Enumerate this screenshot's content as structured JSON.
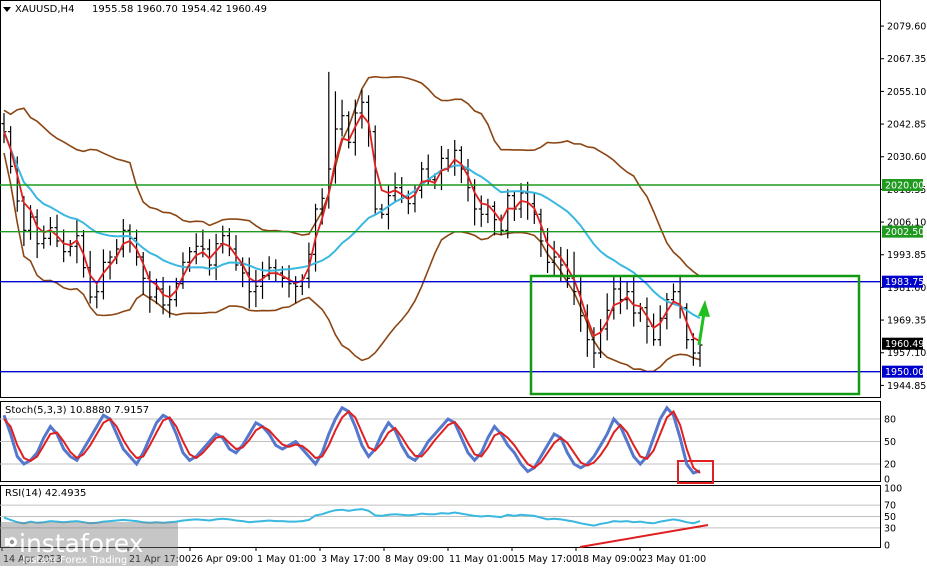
{
  "chart_data": {
    "type": "line",
    "symbol_header": "XAUUSD,H4",
    "ohlc_header": "1955.58 1960.70 1954.42 1960.49",
    "price_axis": {
      "ylim": [
        1940.5,
        2089.0
      ],
      "ticks": [
        "2079.60",
        "2067.35",
        "2055.10",
        "2042.85",
        "2030.60",
        "2018.35",
        "2006.10",
        "1993.85",
        "1981.60",
        "1969.35",
        "1957.10",
        "1944.85"
      ]
    },
    "x_labels": [
      "14 Apr 2023",
      "21 Apr 17:00",
      "26 Apr 09:00",
      "1 May 01:00",
      "3 May 17:00",
      "8 May 09:00",
      "11 May 01:00",
      "15 May 17:00",
      "18 May 09:00",
      "23 May 01:00"
    ],
    "levels": [
      {
        "value": 2020.0,
        "label": "2020.00",
        "color": "#1f9a1f"
      },
      {
        "value": 2002.5,
        "label": "2002.50",
        "color": "#1f9a1f"
      },
      {
        "value": 1983.75,
        "label": "1983.75",
        "color": "#0000cc"
      },
      {
        "value": 1950.0,
        "label": "1950.00",
        "color": "#0000cc"
      }
    ],
    "current_price": {
      "value": 1960.49,
      "label": "1960.49"
    },
    "price_close": [
      2040,
      2027,
      2014,
      2003,
      2008,
      1998,
      2000,
      2004,
      1999,
      1995,
      1997,
      2001,
      1989,
      1978,
      1980,
      1991,
      1993,
      1996,
      2003,
      2000,
      1993,
      1985,
      1978,
      1981,
      1975,
      1977,
      1983,
      1991,
      1995,
      1997,
      1996,
      1990,
      1998,
      2001,
      1996,
      1990,
      1987,
      1980,
      1982,
      1986,
      1989,
      1987,
      1985,
      1983,
      1982,
      1985,
      1994,
      2011,
      2015,
      2026,
      2041,
      2046,
      2036,
      2047,
      2051,
      2040,
      2011,
      2009,
      2016,
      2019,
      2015,
      2013,
      2018,
      2026,
      2022,
      2020,
      2030,
      2027,
      2033,
      2026,
      2019,
      2011,
      2009,
      2012,
      2007,
      2003,
      2016,
      2011,
      2017,
      2013,
      2009,
      1999,
      1991,
      1993,
      1990,
      1985,
      1980,
      1971,
      1962,
      1957,
      1966,
      1973,
      1981,
      1977,
      1980,
      1972,
      1974,
      1967,
      1962,
      1970,
      1977,
      1980,
      1974,
      1962,
      1957,
      1960
    ],
    "stochastic": {
      "label": "Stoch(5,3,3) 10.8880 7.9157",
      "levels": [
        "80",
        "50",
        "20",
        "0"
      ],
      "main": [
        85,
        60,
        30,
        20,
        25,
        35,
        55,
        70,
        60,
        40,
        30,
        25,
        40,
        55,
        70,
        85,
        80,
        60,
        40,
        30,
        20,
        35,
        55,
        75,
        85,
        80,
        60,
        35,
        25,
        30,
        40,
        50,
        60,
        55,
        40,
        35,
        45,
        60,
        75,
        70,
        60,
        45,
        40,
        45,
        50,
        40,
        30,
        20,
        35,
        60,
        80,
        95,
        90,
        70,
        45,
        30,
        40,
        60,
        75,
        65,
        45,
        30,
        25,
        35,
        50,
        60,
        70,
        80,
        75,
        55,
        35,
        25,
        35,
        55,
        70,
        60,
        45,
        35,
        20,
        10,
        15,
        30,
        45,
        60,
        55,
        35,
        20,
        15,
        20,
        30,
        45,
        60,
        80,
        70,
        50,
        30,
        20,
        30,
        55,
        80,
        95,
        85,
        55,
        20,
        8,
        11
      ],
      "signal": [
        80,
        70,
        45,
        28,
        24,
        30,
        45,
        60,
        62,
        50,
        36,
        28,
        33,
        45,
        60,
        75,
        80,
        70,
        52,
        38,
        28,
        30,
        45,
        62,
        78,
        82,
        70,
        50,
        33,
        28,
        35,
        45,
        55,
        57,
        48,
        40,
        42,
        52,
        65,
        70,
        65,
        55,
        46,
        43,
        46,
        44,
        37,
        28,
        30,
        45,
        65,
        82,
        90,
        82,
        62,
        42,
        38,
        48,
        62,
        68,
        56,
        42,
        31,
        30,
        40,
        52,
        62,
        72,
        76,
        65,
        48,
        33,
        30,
        42,
        58,
        62,
        55,
        45,
        32,
        20,
        15,
        22,
        35,
        48,
        55,
        48,
        35,
        22,
        18,
        22,
        32,
        45,
        62,
        72,
        62,
        45,
        30,
        27,
        38,
        60,
        82,
        90,
        72,
        40,
        15,
        8
      ]
    },
    "rsi": {
      "label": "RSI(14) 42.4935",
      "axis_ticks": [
        "100",
        "70",
        "50",
        "30",
        "0"
      ],
      "levels": [
        "70",
        "50",
        "30"
      ],
      "values": [
        48,
        44,
        40,
        38,
        41,
        39,
        40,
        42,
        41,
        40,
        41,
        42,
        40,
        38,
        39,
        41,
        42,
        43,
        44,
        43,
        42,
        40,
        39,
        40,
        39,
        40,
        41,
        43,
        44,
        45,
        44,
        43,
        45,
        46,
        45,
        43,
        42,
        40,
        41,
        42,
        43,
        42,
        42,
        41,
        41,
        42,
        44,
        52,
        54,
        58,
        61,
        62,
        60,
        62,
        63,
        60,
        52,
        51,
        53,
        54,
        53,
        52,
        53,
        55,
        54,
        54,
        56,
        55,
        57,
        55,
        53,
        51,
        50,
        51,
        50,
        49,
        53,
        51,
        53,
        52,
        51,
        48,
        45,
        46,
        45,
        43,
        41,
        38,
        36,
        34,
        37,
        39,
        42,
        41,
        42,
        40,
        41,
        39,
        38,
        41,
        43,
        45,
        43,
        40,
        38,
        42
      ]
    },
    "watermark": {
      "brand": "instaforex",
      "tagline": "Instant Forex Trading"
    }
  }
}
